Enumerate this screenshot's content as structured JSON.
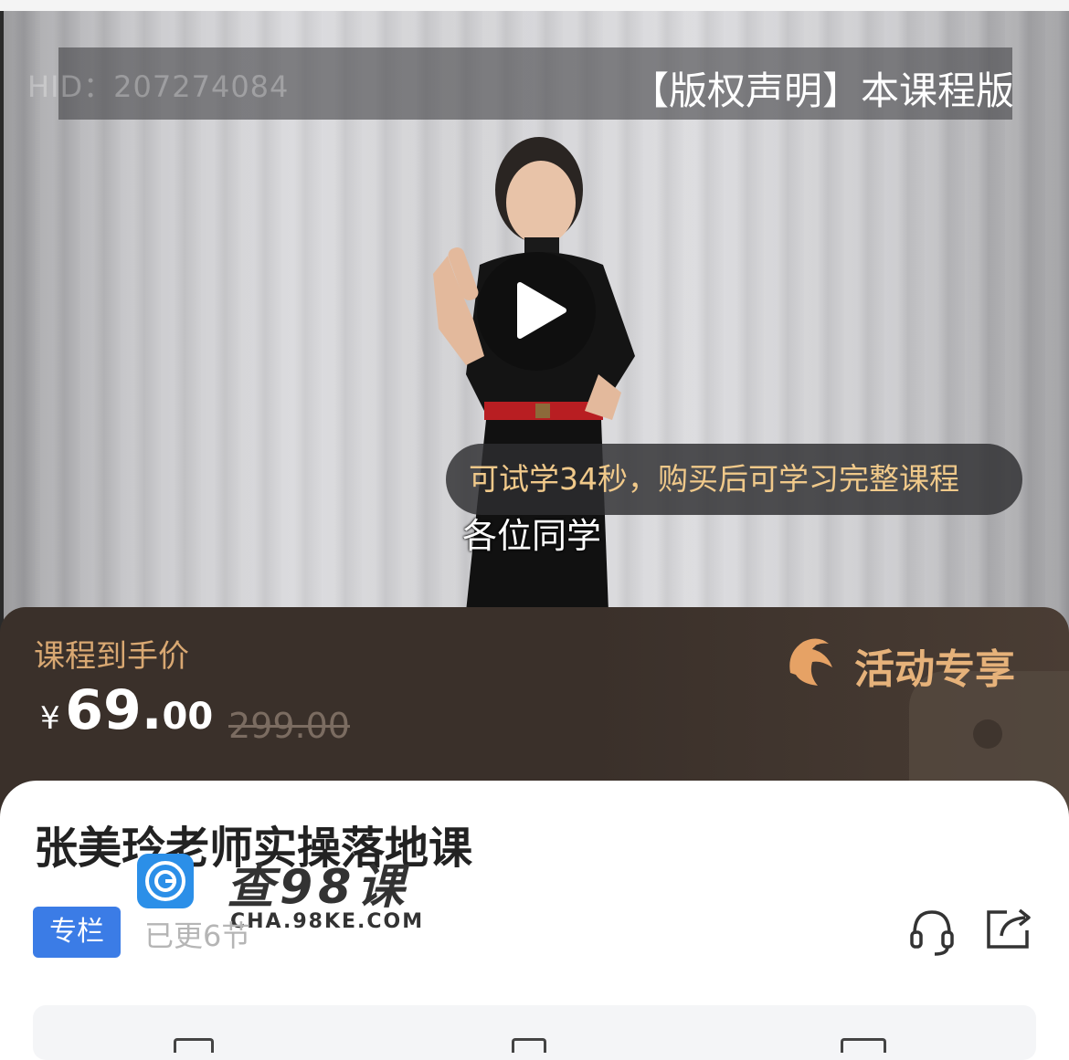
{
  "video": {
    "hid_label": "HID：",
    "hid_value": "207274084",
    "copyright_notice": "【版权声明】本课程版权",
    "trial_notice": "可试学34秒，购买后可学习完整课程",
    "subtitle": "各位同学"
  },
  "price": {
    "label": "课程到手价",
    "currency": "¥",
    "integer": "69.",
    "decimal": "00",
    "original": "299.00",
    "activity_label": "活动专享"
  },
  "course": {
    "title": "张美玲老师实操落地课",
    "tag": "专栏",
    "update_status": "已更6节"
  },
  "watermark": {
    "title": "查98课",
    "url": "CHA.98KE.COM"
  },
  "icons": {
    "play": "play-icon",
    "service": "headset-icon",
    "share": "share-icon",
    "activity": "dolphin-icon"
  },
  "colors": {
    "accent_gold": "#d9a872",
    "tag_blue": "#3b7ce6",
    "band_dark": "#3a302a"
  }
}
